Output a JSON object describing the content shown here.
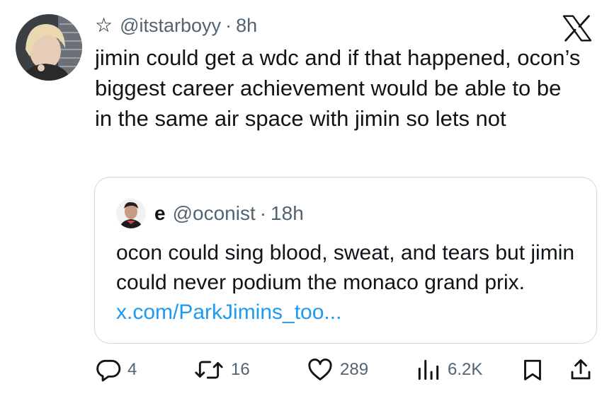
{
  "tweet": {
    "handle": "@itstarboyy",
    "separator": "·",
    "time": "8h",
    "text": "jimin could get a wdc and if that happened, ocon’s biggest career achievement would be able to be in the same air space with jimin so lets not",
    "icons": {
      "favorite": "star-outline-icon",
      "platform": "x-logo-icon"
    }
  },
  "quote": {
    "display_name": "e",
    "handle": "@oconist",
    "separator": "·",
    "time": "18h",
    "text": "ocon could sing blood, sweat, and tears but jimin could never podium the monaco grand prix.",
    "link": "x.com/ParkJimins_too..."
  },
  "actions": {
    "replies": "4",
    "retweets": "16",
    "likes": "289",
    "views": "6.2K"
  },
  "colors": {
    "link": "#1d9bf0",
    "muted": "#536471",
    "text": "#0f1419",
    "border": "#cfd9de"
  }
}
